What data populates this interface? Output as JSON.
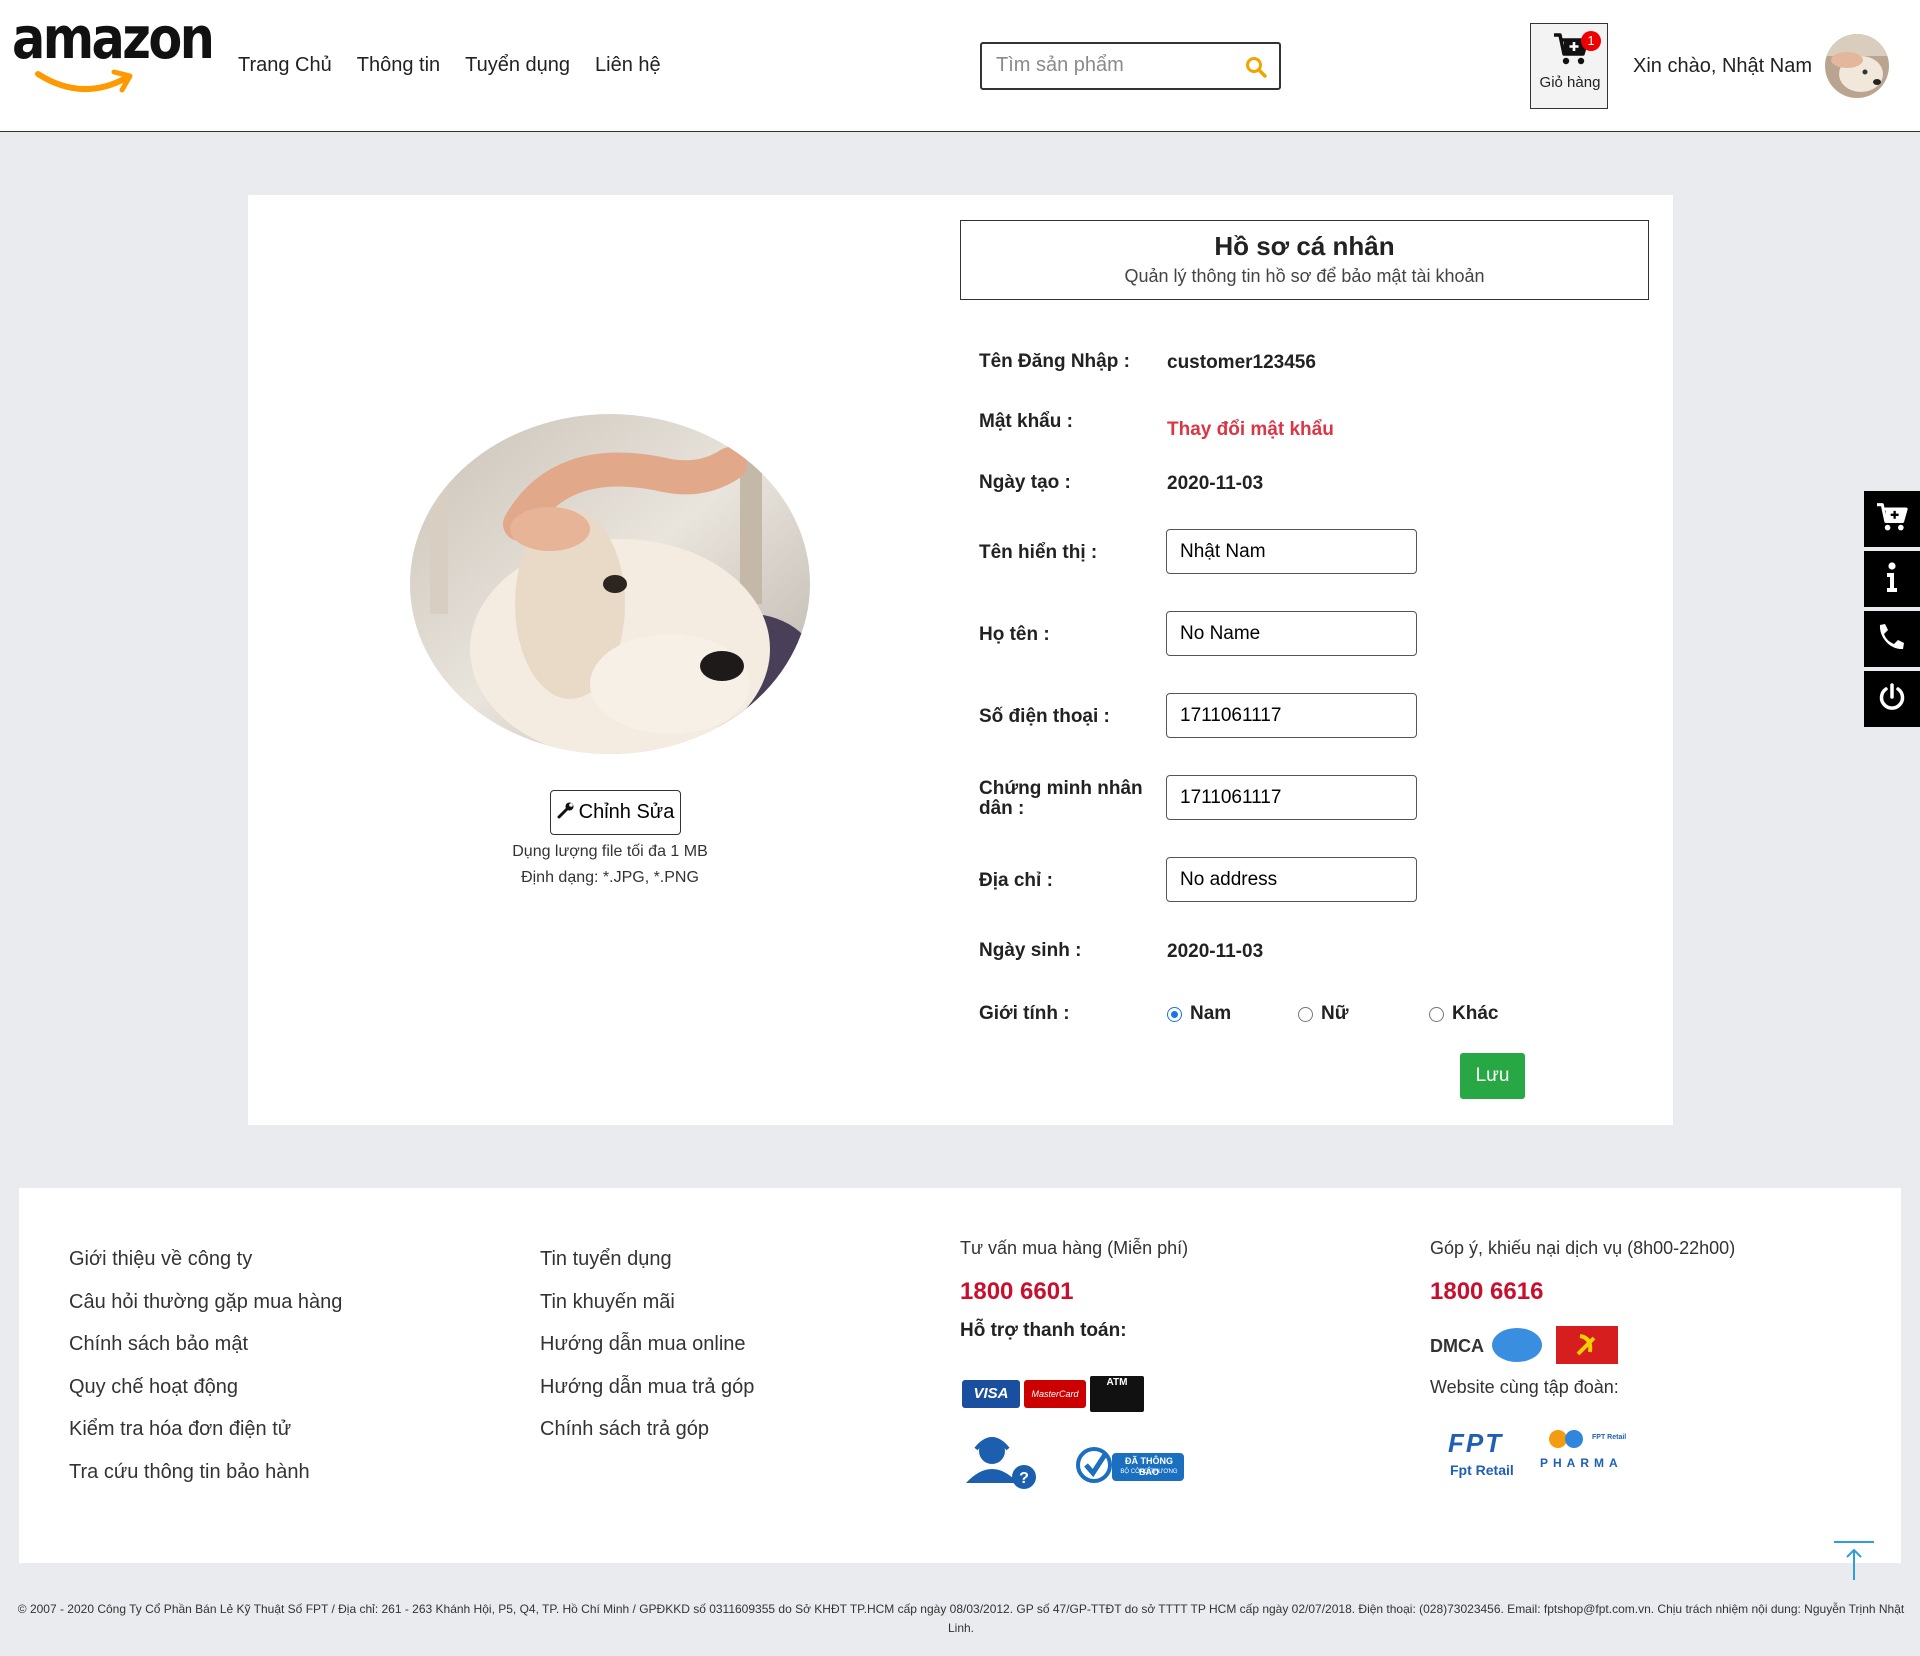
{
  "header": {
    "logo_text": "amazon",
    "nav": [
      "Trang Chủ",
      "Thông tin",
      "Tuyển dụng",
      "Liên hệ"
    ],
    "search_placeholder": "Tìm sản phẩm",
    "cart_label": "Giỏ hàng",
    "cart_count": "1",
    "greeting": "Xin chào, Nhật Nam"
  },
  "profile": {
    "title": "Hồ sơ cá nhân",
    "subtitle": "Quản lý thông tin hồ sơ để bảo mật tài khoản",
    "edit_label": "Chỉnh Sửa",
    "note_size": "Dụng lượng file tối đa 1 MB",
    "note_format": "Định dạng: *.JPG, *.PNG",
    "username_label": "Tên Đăng Nhập :",
    "username": "customer123456",
    "password_label": "Mật khẩu :",
    "password_link": "Thay đổi mật khẩu",
    "created_label": "Ngày tạo :",
    "created": "2020-11-03",
    "display_name_label": "Tên hiển thị :",
    "display_name": "Nhật Nam",
    "full_name_label": "Họ tên :",
    "full_name": "No Name",
    "phone_label": "Số điện thoại :",
    "phone": "1711061117",
    "id_label": "Chứng minh nhân dân :",
    "id_number": "1711061117",
    "address_label": "Địa chỉ :",
    "address": "No address",
    "birthday_label": "Ngày sinh :",
    "birthday": "2020-11-03",
    "gender_label": "Giới tính :",
    "gender_options": [
      "Nam",
      "Nữ",
      "Khác"
    ],
    "gender_selected": "Nam",
    "save_label": "Lưu"
  },
  "footer": {
    "col1": [
      "Giới thiệu về công ty",
      "Câu hỏi thường gặp mua hàng",
      "Chính sách bảo mật",
      "Quy chế hoạt động",
      "Kiểm tra hóa đơn điện tử",
      "Tra cứu thông tin bảo hành"
    ],
    "col2": [
      "Tin tuyển dụng",
      "Tin khuyến mãi",
      "Hướng dẫn mua online",
      "Hướng dẫn mua trả góp",
      "Chính sách trả góp"
    ],
    "consult_label": "Tư vấn mua hàng (Miễn phí)",
    "consult_phone": "1800 6601",
    "payment_label": "Hỗ trợ thanh toán:",
    "complaint_label": "Góp ý, khiếu nại dịch vụ (8h00-22h00)",
    "complaint_phone": "1800 6616",
    "group_label": "Website cùng tập đoàn:",
    "badges": {
      "visa": "VISA",
      "mastercard": "MasterCard",
      "atm": "ATM",
      "registered": "ĐÃ THÔNG BÁO",
      "registered_sub": "BỘ CÔNG THƯƠNG",
      "dmca": "DMCA",
      "fpt": "FPT",
      "fpt_retail": "Fpt Retail",
      "pharma": "PHARMA",
      "pharma_sub": "FPT Retail"
    },
    "copyright": "© 2007 - 2020 Công Ty Cổ Phần Bán Lẻ Kỹ Thuật Số FPT / Địa chỉ: 261 - 263 Khánh Hội, P5, Q4, TP. Hồ Chí Minh / GPĐKKD số 0311609355 do Sở KHĐT TP.HCM cấp ngày 08/03/2012. GP số 47/GP-TTĐT do sở TTTT TP HCM cấp ngày 02/07/2018. Điện thoại: (028)73023456. Email: fptshop@fpt.com.vn. Chịu trách nhiệm nội dung: Nguyễn Trịnh Nhật Linh."
  },
  "colors": {
    "accent_red": "#dc3545",
    "save_green": "#28a745",
    "phone_red": "#c8102e",
    "search_icon": "#f0a500"
  },
  "icons": [
    "search-icon",
    "cart-icon",
    "wrench-icon",
    "info-icon",
    "phone-icon",
    "power-icon",
    "arrow-up-icon"
  ]
}
